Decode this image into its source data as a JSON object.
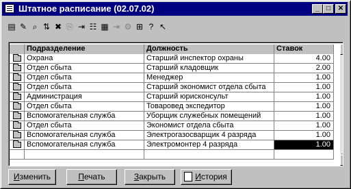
{
  "window": {
    "title": "Штатное расписание (02.07.02)"
  },
  "title_buttons": {
    "minimize": "_",
    "maximize": "□",
    "close": "✕"
  },
  "toolbar": [
    {
      "name": "new-row-icon",
      "glyph": "▤",
      "disabled": false
    },
    {
      "name": "edit-row-icon",
      "glyph": "✎",
      "disabled": false
    },
    {
      "name": "find-icon",
      "glyph": "⌕",
      "disabled": false
    },
    {
      "name": "sort-icon",
      "glyph": "⇅",
      "disabled": false
    },
    {
      "name": "delete-row-icon",
      "glyph": "✖",
      "disabled": false
    },
    {
      "name": "copy-row-icon",
      "glyph": "⎘",
      "disabled": true
    },
    {
      "name": "move-icon",
      "glyph": "⇥",
      "disabled": false
    },
    {
      "name": "tree-icon",
      "glyph": "☷",
      "disabled": false
    },
    {
      "name": "folders-icon",
      "glyph": "▦",
      "disabled": false
    },
    {
      "name": "move-down-icon",
      "glyph": "⇥",
      "disabled": true
    },
    {
      "name": "filter-icon",
      "glyph": "⚙",
      "disabled": true
    },
    {
      "name": "print-icon",
      "glyph": "⊞",
      "disabled": false
    },
    {
      "name": "help-icon",
      "glyph": "?",
      "disabled": false
    },
    {
      "name": "context-help-icon",
      "glyph": "↖",
      "disabled": false
    }
  ],
  "table": {
    "headers": [
      "Подразделение",
      "Должность",
      "Ставок"
    ],
    "rows": [
      [
        "Охрана",
        "Старший инспектор охраны",
        "4.00"
      ],
      [
        "Отдел сбыта",
        "Старший кладовщик",
        "2.00"
      ],
      [
        "Отдел сбыта",
        "Менеджер",
        "1.00"
      ],
      [
        "Отдел сбыта",
        "Старший экономист отдела сбыта",
        "1.00"
      ],
      [
        "Администрация",
        "Старший юрисконсульт",
        "1.00"
      ],
      [
        "Отдел сбыта",
        "Товаровед экспедитор",
        "1.00"
      ],
      [
        "Вспомогательная служба",
        "Уборщик служебных помещений",
        "1.00"
      ],
      [
        "Отдел сбыта",
        "Экономист отдела сбыта",
        "1.00"
      ],
      [
        "Вспомогательная служба",
        "Электрогазосварщик 4 разряда",
        "1.00"
      ],
      [
        "Вспомогательная служба",
        "Электромонтер 4 разряда",
        "1.00"
      ]
    ],
    "selected_row": 9
  },
  "buttons": {
    "edit": {
      "first": "И",
      "rest": "зменить"
    },
    "print": {
      "first": "П",
      "rest": "ечать"
    },
    "close": {
      "first": "З",
      "rest": "акрыть"
    },
    "history": {
      "first": "И",
      "rest": "стория"
    }
  }
}
